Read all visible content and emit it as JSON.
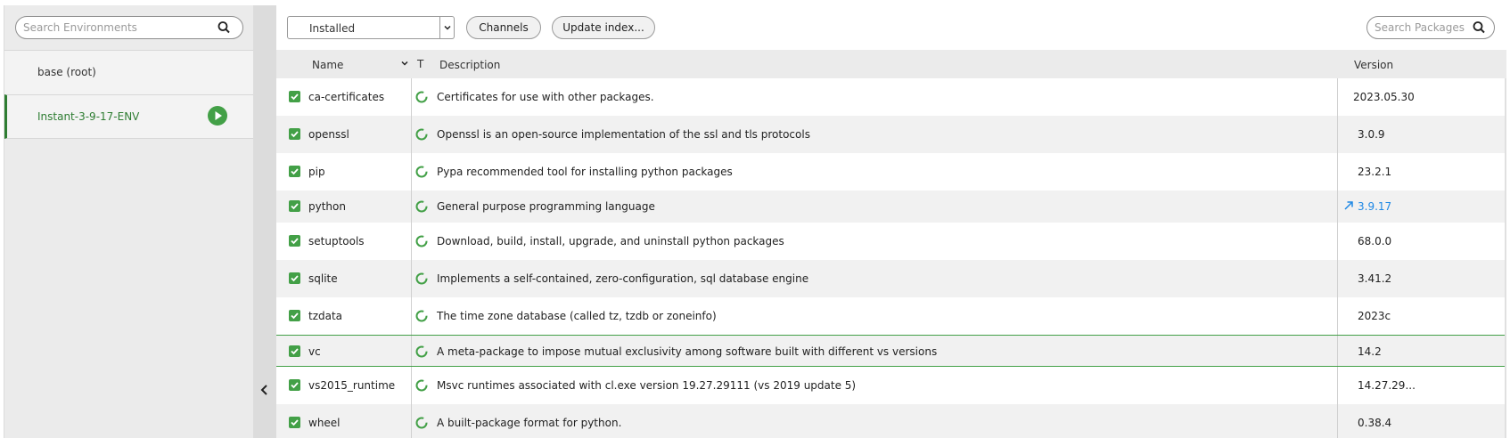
{
  "environments": {
    "search": {
      "placeholder": "Search Environments",
      "icon": "search-icon"
    },
    "items": [
      {
        "name": "base (root)",
        "active": false
      },
      {
        "name": "Instant-3-9-17-ENV",
        "active": true,
        "action_icon": "play-icon"
      }
    ]
  },
  "toolbar": {
    "filter": {
      "selected": "Installed",
      "icon": "chevron-down-icon"
    },
    "channels_label": "Channels",
    "update_label": "Update index...",
    "search": {
      "placeholder": "Search Packages",
      "icon": "search-icon"
    }
  },
  "table": {
    "headers": {
      "name": "Name",
      "type": "T",
      "description": "Description",
      "version": "Version"
    },
    "rows": [
      {
        "name": "ca-certificates",
        "description": "Certificates for use with other packages.",
        "version": "2023.05.30",
        "checked": true,
        "update": false
      },
      {
        "name": "openssl",
        "description": "Openssl is an open-source implementation of the ssl and tls protocols",
        "version": "3.0.9",
        "checked": true,
        "update": false
      },
      {
        "name": "pip",
        "description": "Pypa recommended tool for installing python packages",
        "version": "23.2.1",
        "checked": true,
        "update": false
      },
      {
        "name": "python",
        "description": "General purpose programming language",
        "version": "3.9.17",
        "checked": true,
        "update": true
      },
      {
        "name": "setuptools",
        "description": "Download, build, install, upgrade, and uninstall python packages",
        "version": "68.0.0",
        "checked": true,
        "update": false
      },
      {
        "name": "sqlite",
        "description": "Implements a self-contained, zero-configuration, sql database engine",
        "version": "3.41.2",
        "checked": true,
        "update": false
      },
      {
        "name": "tzdata",
        "description": "The time zone database (called tz, tzdb or zoneinfo)",
        "version": "2023c",
        "checked": true,
        "update": false
      },
      {
        "name": "vc",
        "description": "A meta-package to impose mutual exclusivity among software built with different vs versions",
        "version": "14.2",
        "checked": true,
        "update": false,
        "selected": true
      },
      {
        "name": "vs2015_runtime",
        "description": "Msvc runtimes associated with cl.exe version 19.27.29111 (vs 2019 update 5)",
        "version": "14.27.29...",
        "checked": true,
        "update": false
      },
      {
        "name": "wheel",
        "description": "A built-package format for python.",
        "version": "0.38.4",
        "checked": true,
        "update": false
      }
    ]
  },
  "colors": {
    "accent": "#43a047",
    "accent_dark": "#2e7d32",
    "update": "#1e88e5"
  }
}
